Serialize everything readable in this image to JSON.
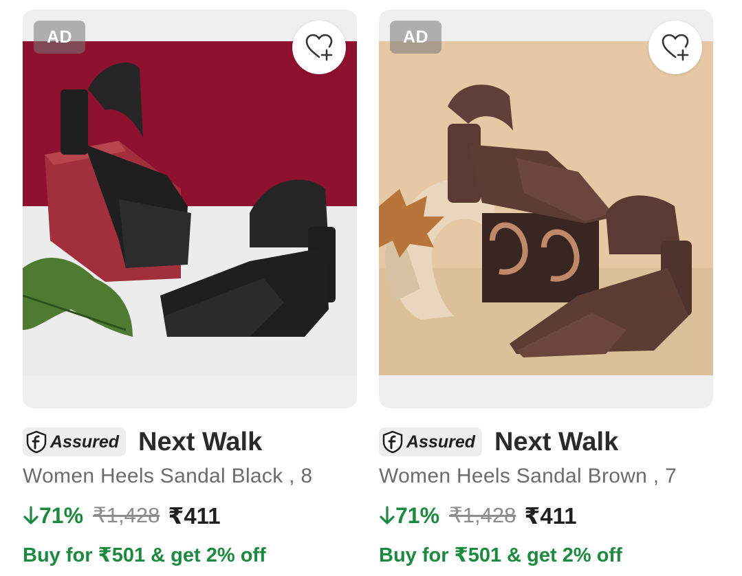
{
  "products": [
    {
      "ad_label": "AD",
      "assured_label": "Assured",
      "brand": "Next Walk",
      "title": "Women Heels Sandal Black , 8",
      "discount": "71%",
      "mrp": "₹1,428",
      "price": "₹411",
      "offer": "Buy for ₹501 & get 2% off",
      "image_colors": {
        "backdrop": "#8e1130",
        "floor": "#ededed",
        "product": "#1e1e1e"
      }
    },
    {
      "ad_label": "AD",
      "assured_label": "Assured",
      "brand": "Next Walk",
      "title": "Women Heels Sandal Brown , 7",
      "discount": "71%",
      "mrp": "₹1,428",
      "price": "₹411",
      "offer": "Buy for ₹501 & get 2% off",
      "image_colors": {
        "backdrop": "#e6c8a4",
        "floor": "#dcc09a",
        "product": "#5a3a33"
      }
    }
  ],
  "icons": {
    "wishlist": "heart-plus-icon",
    "assured": "flipkart-assured-icon",
    "discount": "arrow-down-icon"
  },
  "colors": {
    "discount_green": "#1b8a3e",
    "offer_green": "#1b8a3e",
    "brand_text": "#2a2a2a",
    "title_text": "#6b6b6b",
    "mrp_text": "#8c8c8c"
  }
}
